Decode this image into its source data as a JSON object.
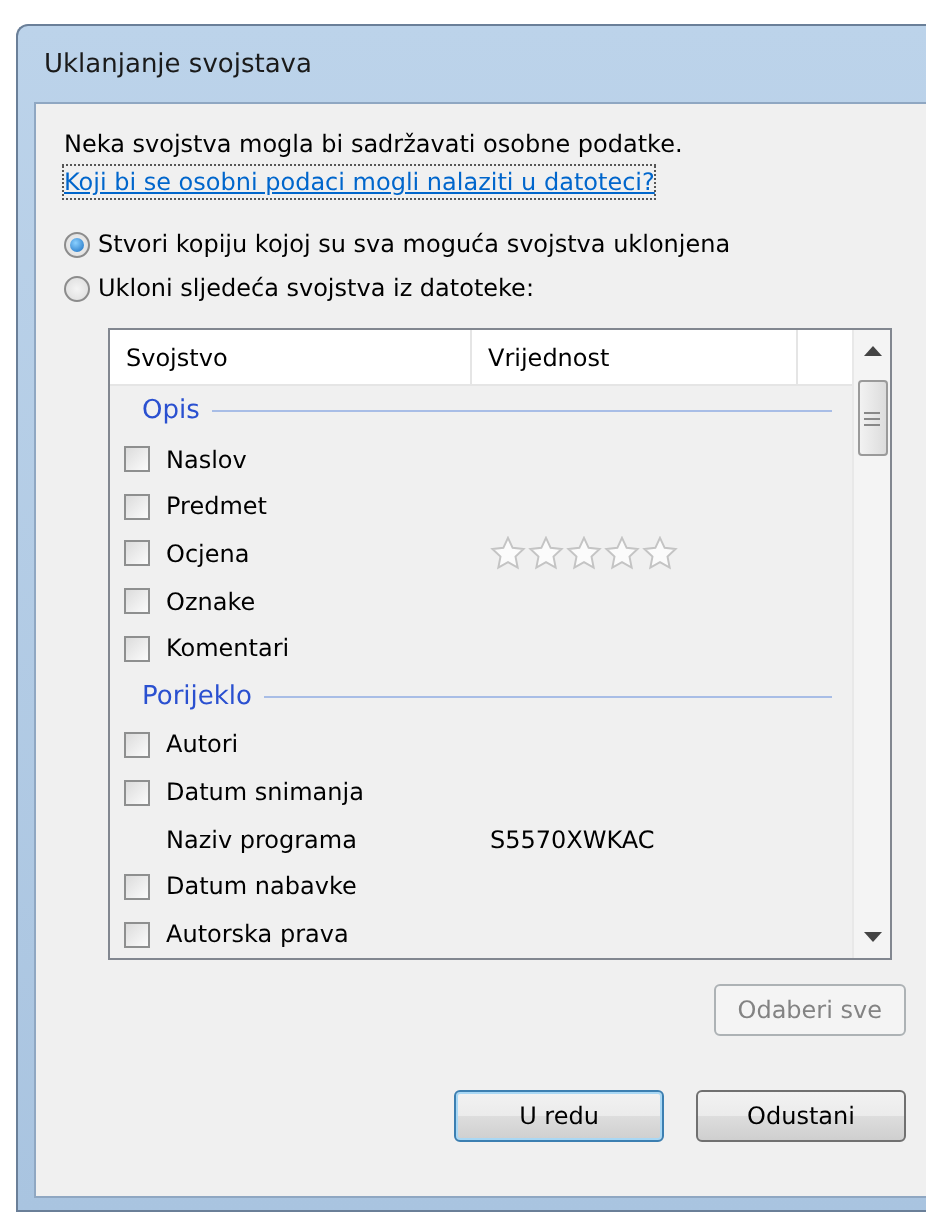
{
  "window": {
    "title": "Uklanjanje svojstava"
  },
  "intro": "Neka svojstva mogla bi sadržavati osobne podatke.",
  "link": "Koji bi se osobni podaci mogli nalaziti u datoteci?",
  "options": [
    {
      "label": "Stvori kopiju kojoj su sva moguća svojstva uklonjena",
      "selected": true
    },
    {
      "label": "Ukloni sljedeća svojstva iz datoteke:",
      "selected": false
    }
  ],
  "table": {
    "columns": [
      "Svojstvo",
      "Vrijednost"
    ],
    "groups": [
      {
        "title": "Opis",
        "rows": [
          {
            "kind": "checkbox",
            "name": "Naslov",
            "checked": false
          },
          {
            "kind": "checkbox",
            "name": "Predmet",
            "checked": false
          },
          {
            "kind": "rating",
            "name": "Ocjena",
            "checked": false,
            "stars": 0
          },
          {
            "kind": "checkbox",
            "name": "Oznake",
            "checked": false
          },
          {
            "kind": "checkbox",
            "name": "Komentari",
            "checked": false
          }
        ]
      },
      {
        "title": "Porijeklo",
        "rows": [
          {
            "kind": "checkbox",
            "name": "Autori",
            "checked": false
          },
          {
            "kind": "checkbox",
            "name": "Datum snimanja",
            "checked": false
          },
          {
            "kind": "plain",
            "name": "Naziv programa",
            "value": "S5570XWKAC"
          },
          {
            "kind": "checkbox",
            "name": "Datum nabavke",
            "checked": false
          },
          {
            "kind": "checkbox",
            "name": "Autorska prava",
            "checked": false
          }
        ]
      }
    ]
  },
  "select_all": {
    "label": "Odaberi sve",
    "disabled": true
  },
  "buttons": [
    {
      "label": "U redu",
      "default": true
    },
    {
      "label": "Odustani",
      "default": false
    }
  ]
}
